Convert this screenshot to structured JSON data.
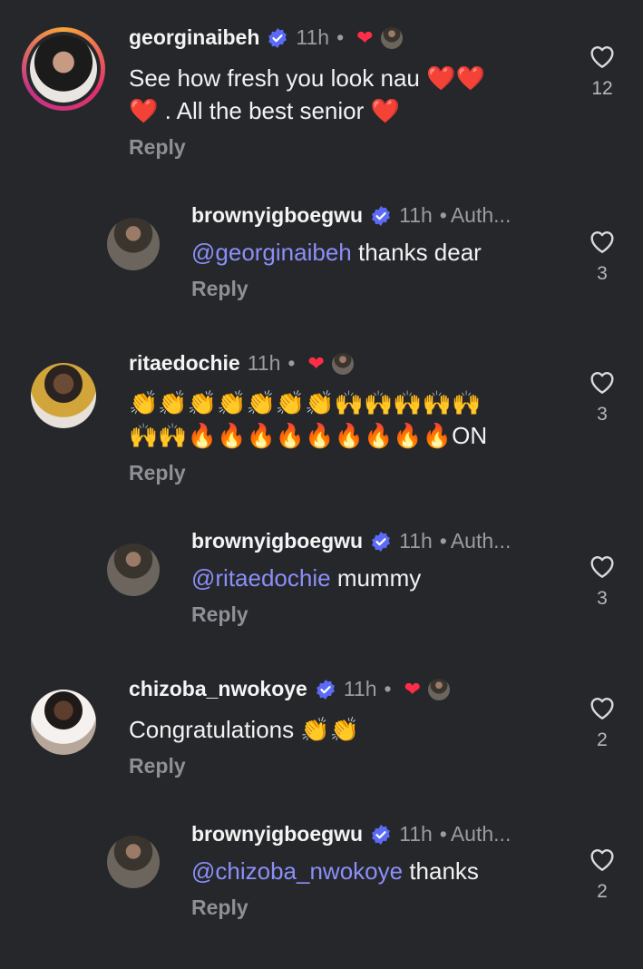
{
  "icons": {
    "verified": "verified-badge-icon",
    "like": "heart-outline-icon",
    "creator_like": "red-heart-icon"
  },
  "colors": {
    "background": "#25272b",
    "mention": "#8b8ff7",
    "verified": "#5b6bf5",
    "heart_red": "#ff2d46"
  },
  "comments": [
    {
      "username": "georginaibeh",
      "verified": true,
      "time": "11h",
      "separator": "•",
      "creator_liked": true,
      "line1": "See how fresh you look nau ❤️❤️",
      "line2": "❤️ . All the best senior ❤️",
      "reply": "Reply",
      "likes": "12"
    },
    {
      "username": "brownyigboegwu",
      "verified": true,
      "time": "11h",
      "separator": "•",
      "author": "Auth...",
      "mention": "@georginaibeh",
      "text": " thanks dear",
      "reply": "Reply",
      "likes": "3"
    },
    {
      "username": "ritaedochie",
      "verified": false,
      "time": "11h",
      "separator": "•",
      "creator_liked": true,
      "line1": "👏👏👏👏👏👏👏🙌🙌🙌🙌🙌",
      "line2": "🙌🙌🔥🔥🔥🔥🔥🔥🔥🔥🔥ON",
      "reply": "Reply",
      "likes": "3"
    },
    {
      "username": "brownyigboegwu",
      "verified": true,
      "time": "11h",
      "separator": "•",
      "author": "Auth...",
      "mention": "@ritaedochie",
      "text": " mummy",
      "reply": "Reply",
      "likes": "3"
    },
    {
      "username": "chizoba_nwokoye",
      "verified": true,
      "time": "11h",
      "separator": "•",
      "creator_liked": true,
      "line1": "Congratulations 👏👏",
      "reply": "Reply",
      "likes": "2"
    },
    {
      "username": "brownyigboegwu",
      "verified": true,
      "time": "11h",
      "separator": "•",
      "author": "Auth...",
      "mention": "@chizoba_nwokoye",
      "text": " thanks",
      "reply": "Reply",
      "likes": "2"
    }
  ]
}
